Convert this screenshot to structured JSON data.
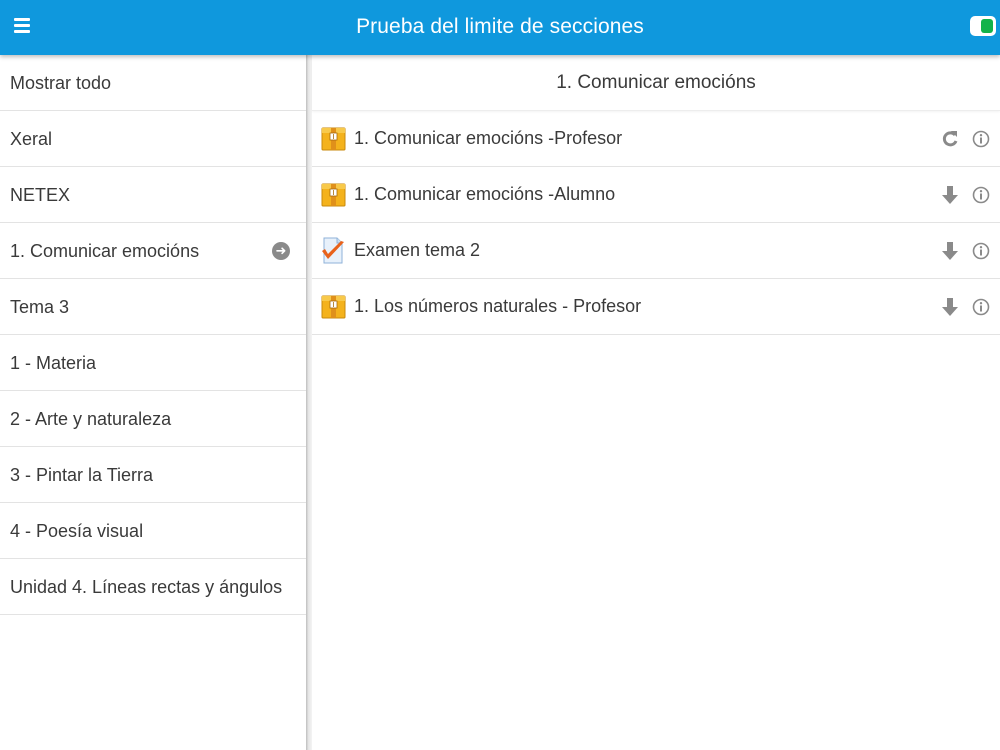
{
  "header": {
    "title": "Prueba del limite de secciones",
    "menu_icon": "hamburger-menu-icon",
    "toggle_icon": "toggle-icon",
    "toggle_color": "#12b34a",
    "bar_color": "#0f98dd"
  },
  "sidebar": {
    "items": [
      {
        "label": "Mostrar todo"
      },
      {
        "label": "Xeral"
      },
      {
        "label": "NETEX"
      },
      {
        "label": "1. Comunicar emocións",
        "selected": true
      },
      {
        "label": "Tema 3"
      },
      {
        "label": "1 - Materia"
      },
      {
        "label": "2 - Arte y naturaleza"
      },
      {
        "label": "3 - Pintar la Tierra"
      },
      {
        "label": "4 - Poesía visual"
      },
      {
        "label": "Unidad 4. Líneas rectas y ángulos"
      }
    ]
  },
  "main": {
    "section_title": "1. Comunicar emocións",
    "modules": [
      {
        "label": "1. Comunicar emocións -Profesor",
        "icon": "package-icon",
        "action_icon": "refresh-icon"
      },
      {
        "label": "1. Comunicar emocións -Alumno",
        "icon": "package-icon",
        "action_icon": "download-icon"
      },
      {
        "label": "Examen tema 2",
        "icon": "quiz-icon",
        "action_icon": "download-icon"
      },
      {
        "label": "1. Los números naturales - Profesor",
        "icon": "package-icon",
        "action_icon": "download-icon"
      }
    ]
  }
}
